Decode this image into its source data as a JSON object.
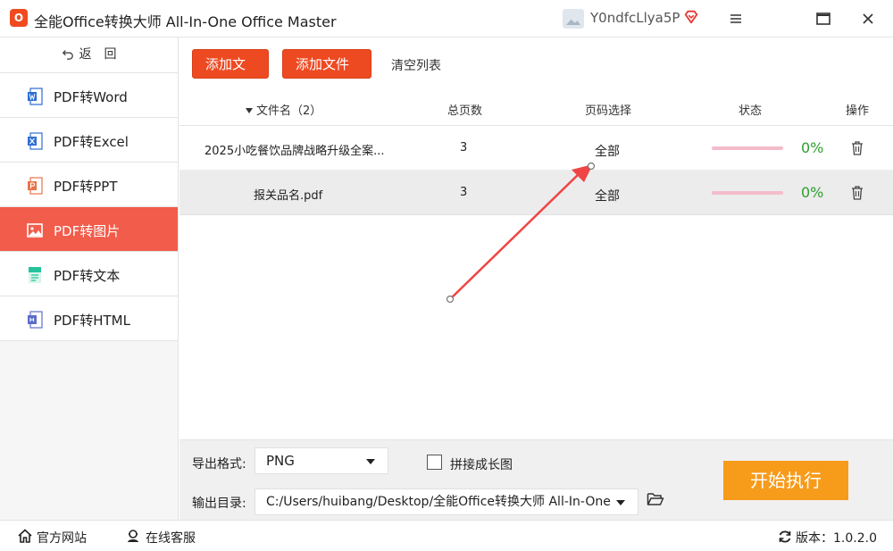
{
  "app": {
    "logo_text": "O",
    "title": "全能Office转换大师 All-In-One Office Master"
  },
  "user": {
    "name": "Y0ndfcLlya5P"
  },
  "sidebar": {
    "back_label": "返　回",
    "items": [
      {
        "label": "PDF转Word",
        "icon": "word-icon",
        "color": "#2b6cd6"
      },
      {
        "label": "PDF转Excel",
        "icon": "excel-icon",
        "color": "#2f6fd0"
      },
      {
        "label": "PDF转PPT",
        "icon": "ppt-icon",
        "color": "#e8734a"
      },
      {
        "label": "PDF转图片",
        "icon": "image-icon",
        "color": "#ffffff",
        "active": true
      },
      {
        "label": "PDF转文本",
        "icon": "text-icon",
        "color": "#25c39a"
      },
      {
        "label": "PDF转HTML",
        "icon": "html-icon",
        "color": "#5c6ec8"
      }
    ]
  },
  "toolbar": {
    "add_file": "添加文件",
    "add_folder": "添加文件夹",
    "clear_list": "清空列表"
  },
  "table": {
    "headers": {
      "name": "文件名（2）",
      "pages": "总页数",
      "range": "页码选择",
      "status": "状态",
      "action": "操作"
    },
    "rows": [
      {
        "name": "2025小吃餐饮品牌战略升级全案...",
        "pages": "3",
        "range": "全部",
        "percent": "0%",
        "progress": 0
      },
      {
        "name": "报关品名.pdf",
        "pages": "3",
        "range": "全部",
        "percent": "0%",
        "progress": 0
      }
    ]
  },
  "bottom": {
    "format_label": "导出格式:",
    "format_value": "PNG",
    "merge_label": "拼接成长图",
    "merge_checked": false,
    "output_label": "输出目录:",
    "output_path": "C:/Users/huibang/Desktop/全能Office转换大师 All-In-One",
    "start_button": "开始执行"
  },
  "footer": {
    "website": "官方网站",
    "support": "在线客服",
    "version": "版本：1.0.2.0"
  },
  "colors": {
    "accent": "#ee4a22",
    "start": "#f79b1b",
    "active_nav": "#f25c4b",
    "success": "#2e9e2e"
  }
}
